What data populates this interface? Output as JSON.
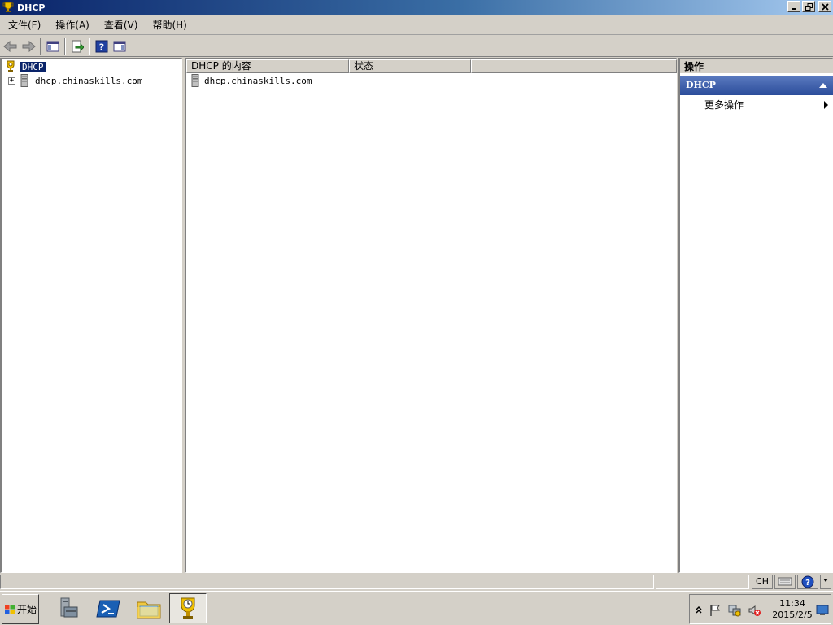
{
  "window": {
    "title": "DHCP"
  },
  "menu": {
    "items": [
      "文件(F)",
      "操作(A)",
      "查看(V)",
      "帮助(H)"
    ]
  },
  "tree": {
    "root_label": "DHCP",
    "child_label": "dhcp.chinaskills.com",
    "expander": "+"
  },
  "content": {
    "columns": [
      "DHCP 的内容",
      "状态",
      ""
    ],
    "rows": [
      {
        "name": "dhcp.chinaskills.com",
        "status": ""
      }
    ]
  },
  "actions": {
    "header": "操作",
    "section_title": "DHCP",
    "items": [
      "更多操作"
    ]
  },
  "statusbar": {
    "lang": "CH"
  },
  "taskbar": {
    "start_label": "开始",
    "clock_time": "11:34",
    "clock_date": "2015/2/5"
  },
  "colors": {
    "title_start": "#0a246a",
    "title_end": "#a6caf0",
    "action_section": "#2b4c9a",
    "selection": "#0a246a"
  },
  "icons": [
    "dhcp-trophy-icon",
    "server-icon",
    "back-icon",
    "forward-icon",
    "show-hide-tree-icon",
    "export-icon",
    "help-icon",
    "show-hide-action-icon",
    "server-manager-icon",
    "powershell-icon",
    "explorer-folder-icon",
    "flag-icon",
    "network-icon",
    "volume-muted-icon",
    "keyboard-icon",
    "help-circle-icon"
  ]
}
